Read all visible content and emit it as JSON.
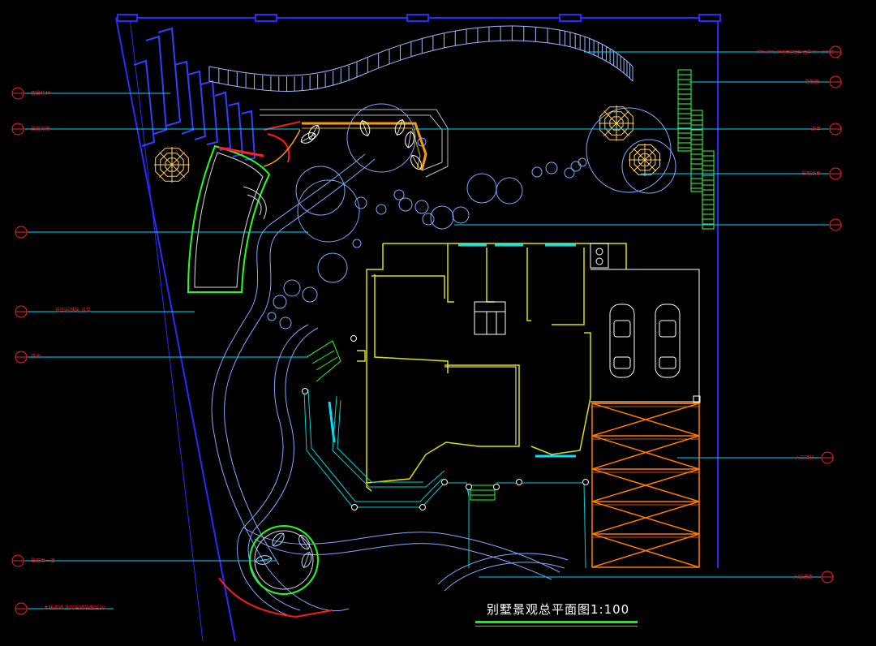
{
  "title": "别墅景观总平面图1:100",
  "colors": {
    "background": "#000000",
    "boundary": "#2a2aff",
    "leader": "#00d8ff",
    "label": "#ff2020",
    "house_wall": "#e0e000",
    "paving_orange": "#ff7a00",
    "lawn_green": "#22ff22",
    "path_line": "#7fa8ff"
  },
  "left_labels": [
    {
      "text": "观景栏杆"
    },
    {
      "text": "景观花架"
    },
    {
      "text": ""
    },
    {
      "text": "花岗岩铺装 详见"
    },
    {
      "text": "花池"
    },
    {
      "text": "景观亭一座"
    },
    {
      "text": "木栈道铺 花岗岩铺装面层20"
    }
  ],
  "right_labels": [
    {
      "text": "300x300x30花岗岩铺装 面层30 入口100"
    },
    {
      "text": "花架廊"
    },
    {
      "text": "凉亭"
    },
    {
      "text": "景观凉亭"
    },
    {
      "text": ""
    },
    {
      "text": "入口铺装"
    },
    {
      "text": "入口道路"
    }
  ]
}
